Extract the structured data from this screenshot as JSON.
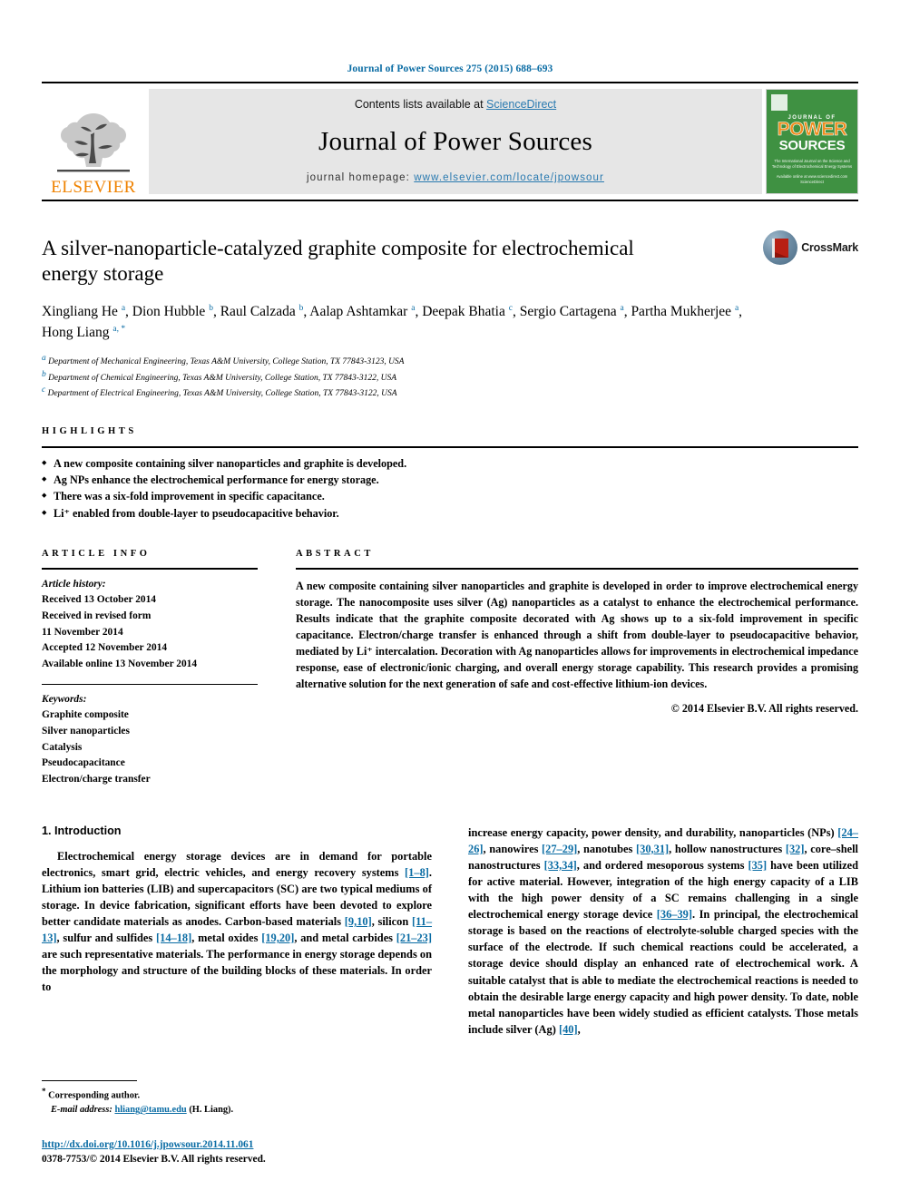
{
  "running_head": "Journal of Power Sources 275 (2015) 688–693",
  "masthead": {
    "publisher_logo_text": "ELSEVIER",
    "contents_prefix": "Contents lists available at ",
    "contents_link": "ScienceDirect",
    "journal_title": "Journal of Power Sources",
    "homepage_prefix": "journal  homepage: ",
    "homepage_url": "www.elsevier.com/locate/jpowsour",
    "cover": {
      "journal_of": "JOURNAL OF",
      "power": "POWER",
      "sources": "SOURCES",
      "subtitle": "The International Journal on the Science and Technology of Electrochemical Energy Systems",
      "footer": "Available online at www.sciencedirect.com  ScienceDirect"
    }
  },
  "article": {
    "title": "A silver-nanoparticle-catalyzed graphite composite for electrochemical energy storage",
    "crossmark_label": "CrossMark",
    "authors": [
      {
        "name": "Xingliang He",
        "marks": "a"
      },
      {
        "name": "Dion Hubble",
        "marks": "b"
      },
      {
        "name": "Raul Calzada",
        "marks": "b"
      },
      {
        "name": "Aalap Ashtamkar",
        "marks": "a"
      },
      {
        "name": "Deepak Bhatia",
        "marks": "c"
      },
      {
        "name": "Sergio Cartagena",
        "marks": "a"
      },
      {
        "name": "Partha Mukherjee",
        "marks": "a"
      },
      {
        "name": "Hong Liang",
        "marks": "a, *"
      }
    ],
    "affiliations": [
      {
        "mark": "a",
        "text": "Department of Mechanical Engineering, Texas A&M University, College Station, TX 77843-3123, USA"
      },
      {
        "mark": "b",
        "text": "Department of Chemical Engineering, Texas A&M University, College Station, TX 77843-3122, USA"
      },
      {
        "mark": "c",
        "text": "Department of Electrical Engineering, Texas A&M University, College Station, TX 77843-3122, USA"
      }
    ]
  },
  "highlights": {
    "label": "HIGHLIGHTS",
    "items": [
      "A new composite containing silver nanoparticles and graphite is developed.",
      "Ag NPs enhance the electrochemical performance for energy storage.",
      "There was a six-fold improvement in specific capacitance.",
      "Li⁺ enabled from double-layer to pseudocapacitive behavior."
    ]
  },
  "article_info": {
    "label": "ARTICLE INFO",
    "history_label": "Article history:",
    "history": [
      "Received 13 October 2014",
      "Received in revised form",
      "11 November 2014",
      "Accepted 12 November 2014",
      "Available online 13 November 2014"
    ],
    "keywords_label": "Keywords:",
    "keywords": [
      "Graphite composite",
      "Silver nanoparticles",
      "Catalysis",
      "Pseudocapacitance",
      "Electron/charge transfer"
    ]
  },
  "abstract": {
    "label": "ABSTRACT",
    "text": "A new composite containing silver nanoparticles and graphite is developed in order to improve electrochemical energy storage. The nanocomposite uses silver (Ag) nanoparticles as a catalyst to enhance the electrochemical performance. Results indicate that the graphite composite decorated with Ag shows up to a six-fold improvement in specific capacitance. Electron/charge transfer is enhanced through a shift from double-layer to pseudocapacitive behavior, mediated by Li⁺ intercalation. Decoration with Ag nanoparticles allows for improvements in electrochemical impedance response, ease of electronic/ionic charging, and overall energy storage capability. This research provides a promising alternative solution for the next generation of safe and cost-effective lithium-ion devices.",
    "copyright": "© 2014 Elsevier B.V. All rights reserved."
  },
  "body": {
    "section_heading": "1. Introduction",
    "left_paragraph_parts": [
      "Electrochemical energy storage devices are in demand for portable electronics, smart grid, electric vehicles, and energy recovery systems ",
      "[1–8]",
      ". Lithium ion batteries (LIB) and supercapacitors (SC) are two typical mediums of storage. In device fabrication, significant efforts have been devoted to explore better candidate materials as anodes. Carbon-based materials ",
      "[9,10]",
      ", silicon ",
      "[11–13]",
      ", sulfur and sulfides ",
      "[14–18]",
      ", metal oxides ",
      "[19,20]",
      ", and metal carbides ",
      "[21–23]",
      " are such representative materials. The performance in energy storage depends on the morphology and structure of the building blocks of these materials. In order to"
    ],
    "right_paragraph_parts": [
      "increase energy capacity, power density, and durability, nanoparticles (NPs) ",
      "[24–26]",
      ", nanowires ",
      "[27–29]",
      ", nanotubes ",
      "[30,31]",
      ", hollow nanostructures ",
      "[32]",
      ", core–shell nanostructures ",
      "[33,34]",
      ", and ordered mesoporous systems ",
      "[35]",
      " have been utilized for active material. However, integration of the high energy capacity of a LIB with the high power density of a SC remains challenging in a single electrochemical energy storage device ",
      "[36–39]",
      ". In principal, the electrochemical storage is based on the reactions of electrolyte-soluble charged species with the surface of the electrode. If such chemical reactions could be accelerated, a storage device should display an enhanced rate of electrochemical work. A suitable catalyst that is able to mediate the electrochemical reactions is needed to obtain the desirable large energy capacity and high power density. To date, noble metal nanoparticles have been widely studied as efficient catalysts. Those metals include silver (Ag) ",
      "[40]",
      ","
    ]
  },
  "footer": {
    "corresponding_author": "Corresponding author.",
    "email_label": "E-mail address:",
    "email": "hliang@tamu.edu",
    "email_suffix": "(H. Liang).",
    "doi": "http://dx.doi.org/10.1016/j.jpowsour.2014.11.061",
    "issn": "0378-7753/© 2014 Elsevier B.V. All rights reserved."
  },
  "colors": {
    "link_blue": "#0a6ca4",
    "elsevier_orange": "#ef8200",
    "cover_green": "#3f9142"
  }
}
